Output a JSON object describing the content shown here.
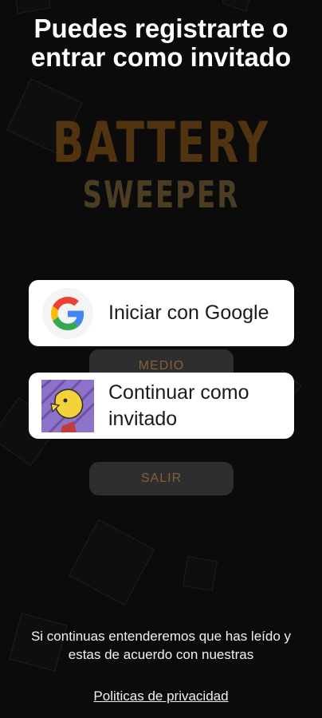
{
  "background": {
    "logo_line1": "BATTERY",
    "logo_line2": "SWEEPER",
    "color": "#0b0b0b"
  },
  "dialog": {
    "title": "Puedes registrarte o entrar como invitado"
  },
  "menu": {
    "medium_label": "MEDIO",
    "exit_label": "SALIR"
  },
  "buttons": {
    "google_label": "Iniciar con Google",
    "guest_label": "Continuar como invitado",
    "google_icon": "google-g-icon",
    "guest_icon": "guest-avatar-icon"
  },
  "footer": {
    "notice": "Si continuas entenderemos que has leído y estas de acuerdo con nuestras",
    "privacy_link": "Politicas de privacidad"
  }
}
